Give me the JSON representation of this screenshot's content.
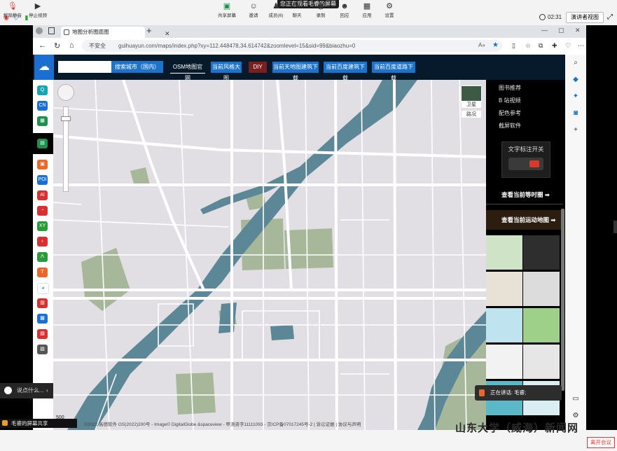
{
  "meeting": {
    "share_banner": "您正在观看毛睿的屏幕",
    "record_time": "02:31",
    "view_button": "演讲者视图",
    "chat_prompt": "说点什么...",
    "sharing_label": "毛睿的屏幕共享",
    "speaking": "正在讲话: 毛睿;",
    "watermark": "山东大学（威海）新闻网",
    "leave_button": "离开会议",
    "toolbar": [
      {
        "label": "解除静音",
        "icon": "mic-icon"
      },
      {
        "label": "停止视频",
        "icon": "video-icon"
      },
      {
        "label": "共享屏幕",
        "icon": "share-screen-icon"
      },
      {
        "label": "邀请",
        "icon": "invite-icon"
      },
      {
        "label": "成员(6)",
        "icon": "members-icon"
      },
      {
        "label": "聊天",
        "icon": "chat-icon"
      },
      {
        "label": "录制",
        "icon": "record-icon"
      },
      {
        "label": "回应",
        "icon": "reaction-icon"
      },
      {
        "label": "应用",
        "icon": "apps-icon"
      },
      {
        "label": "设置",
        "icon": "settings-icon"
      }
    ]
  },
  "browser": {
    "tab_title": "地图分析图底图",
    "unsafe_label": "不安全",
    "url": "guihuayun.com/maps/index.php?xy=112.448478,34.614742&zoomlevel=15&sid=99&biaozhu=0"
  },
  "site": {
    "search_placeholder": "",
    "search_button": "搜索城市（国内）",
    "header_buttons": [
      {
        "label": "OSM地图官网"
      },
      {
        "label": "当前风格大图"
      },
      {
        "label": "DIY"
      },
      {
        "label": "当前天地图建筑下载"
      },
      {
        "label": "当前百度建筑下载"
      },
      {
        "label": "当前百度道路下载"
      }
    ],
    "right_links": [
      "图书推荐",
      "B 站视频",
      "配色参考",
      "截屏软件"
    ],
    "toggle_label": "文字标注开关",
    "promo_1": "查看当前等时圈 ➡",
    "promo_2": "查看当前运动地图 ➡",
    "layer_satellite": "卫星",
    "layer_roads": "路况",
    "scale": "500",
    "copyright": "©2022 高德软件 GS(2022)200号 - Image© DigitalGlobe &spaceview - 甲测资字11111093 - 京ICP备07017245号-2 | 诉讼证据 | 协议与声明"
  },
  "colors": {
    "map_bg": "#e1dfe4",
    "water": "#5b8797",
    "green": "#a7b89a",
    "road": "#ffffff",
    "header_bg": "#061a2c",
    "accent": "#1d72c9"
  }
}
